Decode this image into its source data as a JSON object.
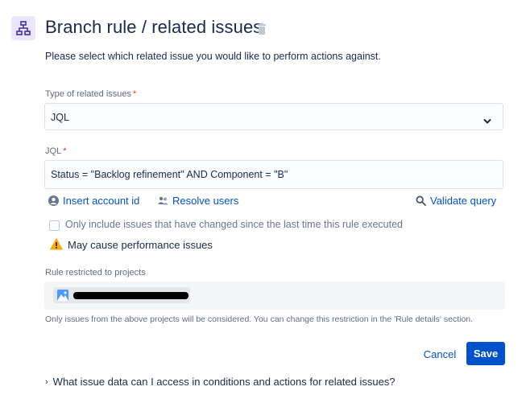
{
  "header": {
    "title": "Branch rule / related issues",
    "icon": "branch-icon",
    "delete_icon": "trash-icon"
  },
  "description": "Please select which related issue you would like to perform actions against.",
  "related_type": {
    "label": "Type of related issues",
    "required_mark": "*",
    "value": "JQL",
    "icon": "chevron-down-icon"
  },
  "jql": {
    "label": "JQL",
    "required_mark": "*",
    "value": "Status = \"Backlog refinement\" AND Component = \"B\""
  },
  "actions": {
    "insert_account": "Insert account id",
    "resolve_users": "Resolve users",
    "validate_query": "Validate query"
  },
  "only_changed": {
    "label": "Only include issues that have changed since the last time this rule executed",
    "checked": false
  },
  "warning": {
    "text": "May cause performance issues",
    "color": "#ffab00"
  },
  "projects": {
    "label": "Rule restricted to projects",
    "hint": "Only issues from the above projects will be considered. You can change this restriction in the 'Rule details' section."
  },
  "footer": {
    "cancel_label": "Cancel",
    "save_label": "Save"
  },
  "faq": {
    "text": "What issue data can I access in conditions and actions for related issues?"
  },
  "colors": {
    "accent": "#0052cc",
    "icon_bg": "#eae6ff",
    "required": "#de350b"
  }
}
